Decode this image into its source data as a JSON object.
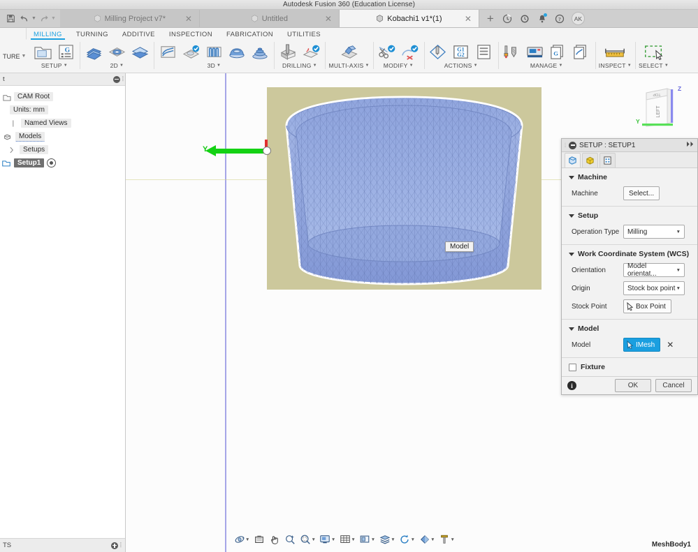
{
  "titlebar": {
    "title": "Autodesk Fusion 360 (Education License)"
  },
  "quick_access": {
    "save_icon": "save-icon",
    "undo_icon": "undo-icon",
    "redo_icon": "redo-icon"
  },
  "document_tabs": [
    {
      "label": "Milling Project v7*",
      "active": false,
      "closable": true
    },
    {
      "label": "Untitled",
      "active": false,
      "closable": true
    },
    {
      "label": "Kobachi1 v1*(1)",
      "active": true,
      "closable": true
    }
  ],
  "tab_actions": {
    "new_tab": "+",
    "icons": [
      "job-status-icon",
      "recent-icon",
      "notifications-icon",
      "help-icon"
    ],
    "avatar": "AK"
  },
  "ribbon_tabs": [
    {
      "label": "MILLING",
      "active": true
    },
    {
      "label": "TURNING",
      "active": false
    },
    {
      "label": "ADDITIVE",
      "active": false
    },
    {
      "label": "INSPECTION",
      "active": false
    },
    {
      "label": "FABRICATION",
      "active": false
    },
    {
      "label": "UTILITIES",
      "active": false
    }
  ],
  "workspace_selector": {
    "label": "TURE",
    "caret": "▾"
  },
  "ribbon_groups": [
    {
      "label": "SETUP",
      "caret": "▾",
      "buttons": [
        "new-setup-icon",
        "setup-from-part-icon"
      ]
    },
    {
      "label": "2D",
      "caret": "▾",
      "buttons": [
        "face-icon",
        "adaptive2d-icon",
        "pocket2d-icon"
      ]
    },
    {
      "label": "3D",
      "caret": "▾",
      "buttons": [
        "adaptive3d-icon",
        "pocket3d-icon",
        "parallel-icon",
        "scallop-icon",
        "spiral-icon"
      ]
    },
    {
      "label": "DRILLING",
      "caret": "▾",
      "buttons": [
        "drill-icon",
        "bore-icon"
      ]
    },
    {
      "label": "MULTI-AXIS",
      "caret": "▾",
      "buttons": [
        "multiaxis-contour-icon"
      ]
    },
    {
      "label": "MODIFY",
      "caret": "▾",
      "buttons": [
        "trim-toolpath-icon",
        "delete-toolpath-icon"
      ]
    },
    {
      "label": "ACTIONS",
      "caret": "▾",
      "buttons": [
        "simulate-icon",
        "post-process-icon",
        "setup-sheet-icon"
      ]
    },
    {
      "label": "MANAGE",
      "caret": "▾",
      "buttons": [
        "tool-library-icon",
        "machine-library-icon",
        "post-library-icon",
        "template-library-icon"
      ]
    },
    {
      "label": "INSPECT",
      "caret": "▾",
      "buttons": [
        "measure-icon"
      ]
    },
    {
      "label": "SELECT",
      "caret": "▾",
      "buttons": [
        "select-window-icon"
      ]
    }
  ],
  "browser": {
    "header_label": "t",
    "collapse_icon": "collapse-icon",
    "tree": [
      {
        "label": "CAM Root",
        "icon": "cam-root-icon",
        "indent": 0,
        "selected": false
      },
      {
        "label": "Units: mm",
        "icon": "",
        "indent": 1,
        "selected": false
      },
      {
        "label": "Named Views",
        "icon": "folder-icon",
        "indent": 1,
        "selected": false
      },
      {
        "label": "Models",
        "icon": "models-icon",
        "indent": 1,
        "selected": false
      },
      {
        "label": "Setups",
        "icon": "",
        "indent": 1,
        "selected": false
      },
      {
        "label": "Setup1",
        "icon": "setup-folder-icon",
        "indent": 2,
        "selected": true
      }
    ],
    "footer_label": "TS",
    "footer_icon": "expand-icon"
  },
  "viewport": {
    "axis_label_y": "Y",
    "model_tooltip": "Model",
    "body_name": "MeshBody1",
    "viewcube_face": "LEFT",
    "viewcube_top": "TOP",
    "viewcube_axis_z": "Z",
    "viewcube_axis_y": "Y",
    "stock_color": "#ccc89c",
    "model_color": "#8fa4dd",
    "y_axis_color": "#14d214",
    "z_axis_color": "#e03030"
  },
  "navbar": [
    {
      "icon": "orbit-icon",
      "caret": true
    },
    {
      "icon": "look-at-icon",
      "caret": false
    },
    {
      "icon": "pan-icon",
      "caret": false
    },
    {
      "icon": "zoom-icon",
      "caret": false
    },
    {
      "icon": "zoom-window-icon",
      "caret": true
    },
    {
      "icon": "display-settings-icon",
      "caret": true
    },
    {
      "icon": "grid-snaps-icon",
      "caret": true
    },
    {
      "icon": "viewports-icon",
      "caret": true
    },
    {
      "icon": "visual-style-icon",
      "caret": true
    },
    {
      "icon": "refresh-icon",
      "caret": true
    },
    {
      "icon": "appearance-icon",
      "caret": true
    },
    {
      "icon": "tool-filter-icon",
      "caret": true
    }
  ],
  "properties_panel": {
    "title": "SETUP : SETUP1",
    "collapse_icon": "minimize-icon",
    "expand_icon": "expand-right-icon",
    "tabs": [
      {
        "icon": "setup-tab-icon",
        "active": true
      },
      {
        "icon": "stock-tab-icon",
        "active": false
      },
      {
        "icon": "post-process-tab-icon",
        "active": false
      }
    ],
    "sections": [
      {
        "title": "Machine",
        "expanded": true,
        "fields": [
          {
            "label": "Machine",
            "control": "button",
            "value": "Select..."
          }
        ]
      },
      {
        "title": "Setup",
        "expanded": true,
        "fields": [
          {
            "label": "Operation Type",
            "control": "dropdown",
            "value": "Milling"
          }
        ]
      },
      {
        "title": "Work Coordinate System (WCS)",
        "expanded": true,
        "fields": [
          {
            "label": "Orientation",
            "control": "dropdown",
            "value": "Model orientat..."
          },
          {
            "label": "Origin",
            "control": "dropdown",
            "value": "Stock box point"
          },
          {
            "label": "Stock Point",
            "control": "select",
            "value": "Box Point"
          }
        ]
      },
      {
        "title": "Model",
        "expanded": true,
        "fields": [
          {
            "label": "Model",
            "control": "select-active",
            "value": "IMesh",
            "clear": "✕"
          }
        ]
      }
    ],
    "fixture": {
      "label": "Fixture",
      "checked": false
    },
    "footer": {
      "info_icon": "info-icon",
      "ok_label": "OK",
      "cancel_label": "Cancel"
    }
  },
  "colors": {
    "accent": "#1a9fe0",
    "chrome": "#f4f4f4",
    "tabstrip": "#cfcfcf",
    "panel_bg": "#f2f2f2"
  }
}
